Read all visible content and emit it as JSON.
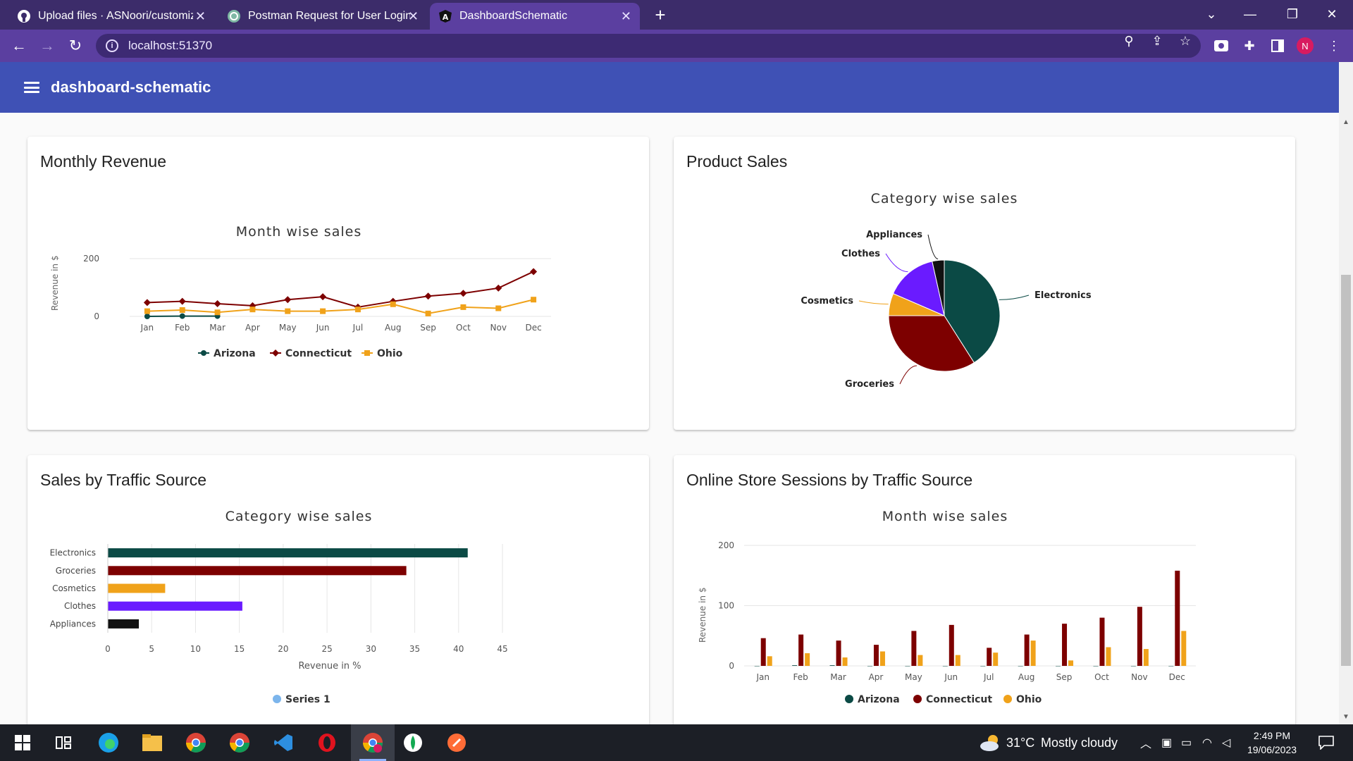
{
  "browser": {
    "tabs": [
      {
        "title": "Upload files · ASNoori/customize",
        "favicon": "github-icon"
      },
      {
        "title": "Postman Request for User Login",
        "favicon": "openai-icon"
      },
      {
        "title": "DashboardSchematic",
        "favicon": "angular-icon"
      }
    ],
    "url": "localhost:51370",
    "profile_initial": "N"
  },
  "app": {
    "title": "dashboard-schematic"
  },
  "cards": {
    "monthly_revenue": {
      "title": "Monthly Revenue"
    },
    "product_sales": {
      "title": "Product Sales"
    },
    "sales_traffic": {
      "title": "Sales by Traffic Source"
    },
    "sessions_traffic": {
      "title": "Online Store Sessions by Traffic Source"
    }
  },
  "colors": {
    "arizona": "#0b4a45",
    "connecticut": "#7d0000",
    "ohio": "#f0a21a",
    "clothes": "#6a1bff",
    "appliances": "#111111",
    "series1": "#7cb5ec"
  },
  "chart_data": [
    {
      "type": "line",
      "title": "Month wise sales",
      "ylabel": "Revenue in $",
      "xlabel": "",
      "categories": [
        "Jan",
        "Feb",
        "Mar",
        "Apr",
        "May",
        "Jun",
        "Jul",
        "Aug",
        "Sep",
        "Oct",
        "Nov",
        "Dec"
      ],
      "ylim": [
        0,
        200
      ],
      "yticks": [
        0,
        200
      ],
      "legend": "bottom",
      "series": [
        {
          "name": "Arizona",
          "values": [
            0,
            1,
            1,
            null,
            null,
            null,
            null,
            null,
            null,
            null,
            null,
            null
          ]
        },
        {
          "name": "Connecticut",
          "values": [
            48,
            52,
            44,
            37,
            58,
            68,
            32,
            52,
            70,
            80,
            98,
            155
          ]
        },
        {
          "name": "Ohio",
          "values": [
            18,
            22,
            14,
            24,
            18,
            18,
            24,
            42,
            10,
            32,
            28,
            58
          ]
        }
      ]
    },
    {
      "type": "pie",
      "title": "Category wise sales",
      "slices": [
        {
          "name": "Electronics",
          "value": 41
        },
        {
          "name": "Groceries",
          "value": 34
        },
        {
          "name": "Cosmetics",
          "value": 6.5
        },
        {
          "name": "Clothes",
          "value": 15
        },
        {
          "name": "Appliances",
          "value": 3.5
        }
      ]
    },
    {
      "type": "bar",
      "orientation": "horizontal",
      "title": "Category wise sales",
      "xlabel": "Revenue in %",
      "categories": [
        "Electronics",
        "Groceries",
        "Cosmetics",
        "Clothes",
        "Appliances"
      ],
      "values": [
        41,
        34,
        6.5,
        15.3,
        3.5
      ],
      "xlim": [
        0,
        45
      ],
      "xticks": [
        0,
        5,
        10,
        15,
        20,
        25,
        30,
        35,
        40,
        45
      ],
      "legend": "bottom",
      "series_name": "Series 1"
    },
    {
      "type": "bar",
      "title": "Month wise sales",
      "ylabel": "Revenue in $",
      "categories": [
        "Jan",
        "Feb",
        "Mar",
        "Apr",
        "May",
        "Jun",
        "Jul",
        "Aug",
        "Sep",
        "Oct",
        "Nov",
        "Dec"
      ],
      "ylim": [
        0,
        200
      ],
      "yticks": [
        0,
        100,
        200
      ],
      "legend": "bottom",
      "series": [
        {
          "name": "Arizona",
          "values": [
            0,
            1,
            1,
            0,
            0,
            0,
            0,
            0,
            0,
            0,
            0,
            0
          ]
        },
        {
          "name": "Connecticut",
          "values": [
            46,
            52,
            42,
            35,
            58,
            68,
            30,
            52,
            70,
            80,
            98,
            158
          ]
        },
        {
          "name": "Ohio",
          "values": [
            16,
            21,
            14,
            24,
            18,
            18,
            22,
            42,
            9,
            31,
            28,
            58
          ]
        }
      ]
    }
  ],
  "taskbar": {
    "weather_temp": "31°C",
    "weather_text": "Mostly cloudy",
    "time": "2:49 PM",
    "date": "19/06/2023"
  }
}
